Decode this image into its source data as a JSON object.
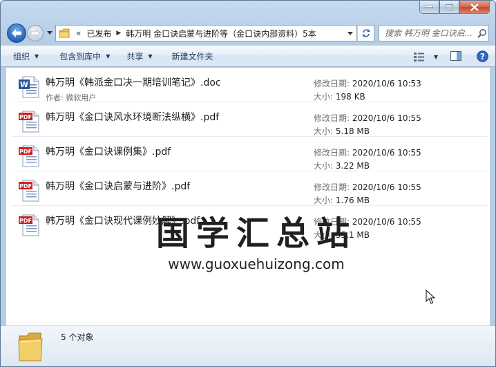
{
  "window": {
    "caption_buttons": [
      "minimize",
      "maximize",
      "close"
    ]
  },
  "nav": {
    "address": {
      "overflow": "«",
      "crumbs": [
        "已发布",
        "韩万明 金口诀启蒙与进阶等（金口诀内部资料）5本"
      ]
    },
    "search_placeholder": "搜索 韩万明 金口诀启..."
  },
  "toolbar": {
    "organize": "组织",
    "include_in_library": "包含到库中",
    "share": "共享",
    "new_folder": "新建文件夹"
  },
  "labels": {
    "modified": "修改日期:",
    "size": "大小:",
    "author": "作者:"
  },
  "files": [
    {
      "name": "韩万明《韩派金口决一期培训笔记》.doc",
      "type": "doc",
      "author": "微软用户",
      "modified": "2020/10/6 10:53",
      "size": "198 KB"
    },
    {
      "name": "韩万明《金口诀风水环境断法纵横》.pdf",
      "type": "pdf",
      "modified": "2020/10/6 10:55",
      "size": "5.18 MB"
    },
    {
      "name": "韩万明《金口诀课例集》.pdf",
      "type": "pdf",
      "modified": "2020/10/6 10:55",
      "size": "3.22 MB"
    },
    {
      "name": "韩万明《金口诀启蒙与进阶》.pdf",
      "type": "pdf",
      "modified": "2020/10/6 10:55",
      "size": "1.76 MB"
    },
    {
      "name": "韩万明《金口诀现代课例妙解》.pdf",
      "type": "pdf",
      "modified": "2020/10/6 10:55",
      "size": "35.1 MB"
    }
  ],
  "watermark": {
    "title": "国学汇总站",
    "url": "www.guoxuehuizong.com"
  },
  "status": {
    "count": "5 个对象"
  },
  "colors": {
    "pdf_red": "#c8231e",
    "word_blue": "#2a5699",
    "folder_yellow": "#e8c35a"
  }
}
